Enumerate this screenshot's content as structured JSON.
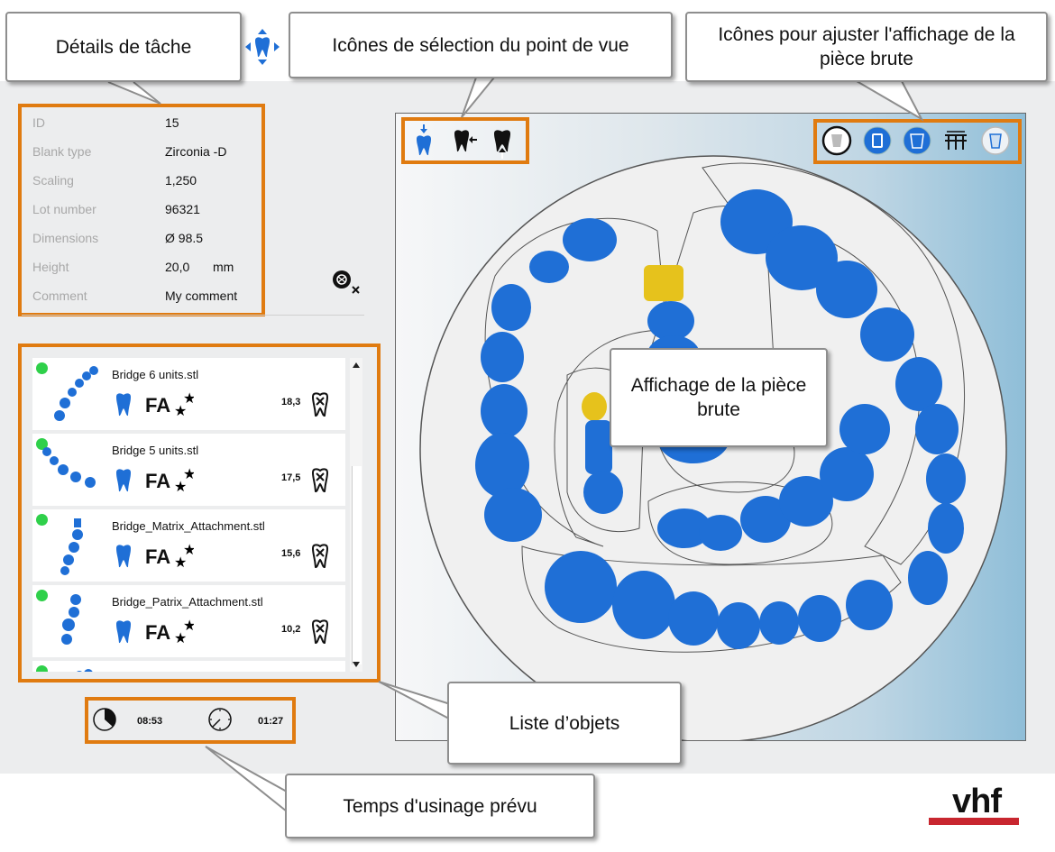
{
  "callouts": {
    "task_details": "Détails de tâche",
    "view_selection": "Icônes de sélection du point de vue",
    "blank_display_adjust": "Icônes pour ajuster l'affichage de la pièce brute",
    "blank_display": "Affichage de la pièce brute",
    "object_list": "Liste d’objets",
    "machining_time": "Temps d'usinage prévu"
  },
  "details": {
    "id_label": "ID",
    "id_value": "15",
    "blank_type_label": "Blank type",
    "blank_type_value": "Zirconia -D",
    "scaling_label": "Scaling",
    "scaling_value": "1,250",
    "lot_label": "Lot number",
    "lot_value": "96321",
    "dimensions_label": "Dimensions",
    "dimensions_value": "Ø 98.5",
    "height_label": "Height",
    "height_value": "20,0",
    "height_unit": "mm",
    "comment_label": "Comment",
    "comment_value": "My comment"
  },
  "objects": [
    {
      "name": "Bridge 6 units.stl",
      "strategy": "FA",
      "value": "18,3"
    },
    {
      "name": "Bridge 5 units.stl",
      "strategy": "FA",
      "value": "17,5"
    },
    {
      "name": "Bridge_Matrix_Attachment.stl",
      "strategy": "FA",
      "value": "15,6"
    },
    {
      "name": "Bridge_Patrix_Attachment.stl",
      "strategy": "FA",
      "value": "10,2"
    }
  ],
  "times": {
    "total": "08:53",
    "remaining": "01:27"
  },
  "icons": {
    "view_icons": [
      "tooth-top-view-icon",
      "tooth-side-view-icon",
      "tooth-bottom-view-icon"
    ],
    "display_icons": [
      "blank-outline-icon",
      "blank-solid-icon",
      "blank-filled-icon",
      "connectors-icon",
      "blank-transparent-icon"
    ]
  },
  "colors": {
    "accent_orange": "#e07b10",
    "status_green": "#2fd04a",
    "tooth_blue": "#1f6fd6",
    "attachment_yellow": "#e6c21c",
    "brand_red": "#c8262f"
  },
  "brand": {
    "logo": "vhf"
  }
}
